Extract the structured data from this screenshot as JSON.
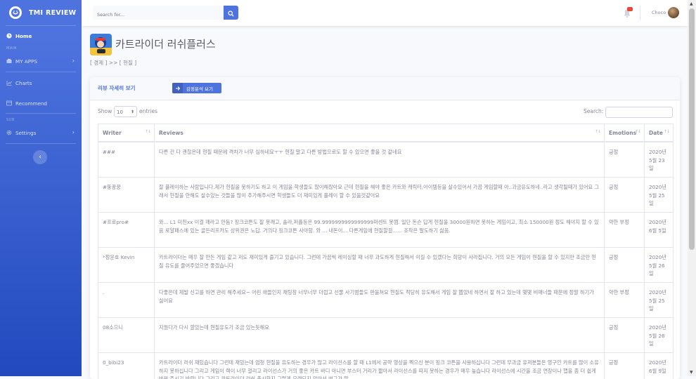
{
  "brand": {
    "name": "TMI REVIEW"
  },
  "sidebar": {
    "home": "Home",
    "heading_main": "MAIN",
    "my_apps": "MY APPS",
    "charts": "Charts",
    "recommend": "Recommend",
    "heading_sub": "SUB",
    "settings": "Settings"
  },
  "topbar": {
    "search_placeholder": "Search for...",
    "notification_count": "",
    "user_name": "Choco"
  },
  "page": {
    "app_title": "카트라이더 러쉬플러스",
    "breadcrumb": "[ 경제 ] >> [ 현질 ]"
  },
  "card": {
    "title": "리뷰 자세히 보기",
    "sentiment_button": "감정분석 보기"
  },
  "table_controls": {
    "show_label": "Show",
    "page_size": "10",
    "entries_label": "entries",
    "search_label": "Search:"
  },
  "table": {
    "headers": [
      "Writer",
      "Reviews",
      "Emotions",
      "Date"
    ],
    "rows": [
      {
        "writer": "###",
        "review": "다른 건 다 괜찮은데 현질 때문에 격차가 너무 심하네요ㅜㅜ 현질 말고 다른 방법으로도 할 수 있으면 좋을 것 같네요",
        "emotion": "긍정",
        "date": "2020년 5월 23일"
      },
      {
        "writer": "#뚱꿍꿍",
        "review": "잘 플레이하는 사람입니다.제가 현질을 못하기도 하고 이 게임을 학생들도 많이해잖아요 근데 현질을 해야 좋은 카트와 캐릭터,아이템등을 살수있어서 가끔 게임할때 아..과금유도하네..라고 생각될때가 있어요 그래서 현질을 안해도 살수있는 것들을 많이 추가해주시면 학생들도 더 재미있게 플레이 할 수 있을것같아요",
        "emotion": "긍정",
        "date": "2020년 5월 25일"
      },
      {
        "writer": "#프로pro#",
        "review": "와... L1 미친xx 이걸 깨라고 만듬? 핑크코튼도 잘 못깨고, 솔라,퍼플등은 99.9999999999999999퍼센트 못깸. 일단 돈슨 답게 현질을 30000원하면 못하는 게임이고, 최소 150000원 정도 해야지 할 수 있음 로얄패스에 있는 골든리프카도 상위권은 노답. 거의다 핑크코튼 사야함. 와 ... 내돈이... 다른게임에 현질할걸...... 조작은 말도하기 싫음.",
        "emotion": "약한 부정",
        "date": "2020년 6월 5일"
      },
      {
        "writer": "*정윤호 Kevin",
        "review": "카트라이더는 매우 잘 만든 게임 같고 저도 재미있게 즐기고 있습니다. 그런데 가끔씩 레이싱할 때 너무 과도하게 현질해서 이길 수 있겠다는 희망이 사라집니다. 거의 모든 게임이 현질을 할 수 있지만 조금만 현질 유도를 줄여주었으면 좋겠습니다",
        "emotion": "긍정",
        "date": "2020년 5월 26일"
      },
      {
        "writer": ".",
        "review": "다좋은데 제발 신고를 하면 관리 해주세요~ 어린 애들인지 채팅창 너무너무 더럽고 선물 사기범들도 판을쳐요 현질도 적당히 유도해서 게임 잘 뽑았네 하면서 잘 하고 있는데 몇몇 비매너들 때문에 정말 하기가 싫어요",
        "emotion": "약한 부정",
        "date": "2020년 5월 25일"
      },
      {
        "writer": "08소으니",
        "review": "지웠다가 다시 깔았는데 현질유도가 조금 있는듯해요",
        "emotion": "긍정",
        "date": "2020년 5월 26일"
      },
      {
        "writer": "0_bibi23",
        "review": "카트라이더 러쉬 재밌습니다 그런데 재밌는데 엄청 현질을 유도하는 경우가 많고 라이선스를 할 때 L1에서 공략 영상을 찍으신 분이 핑크 코튼을 사용하십니다 그런데 무과금 유저분들은 영구인 카트를 많이 소유하지 못하십니다 그리고 게임이 렉이 너무 걸리고 라이선스가 거의 좋은 카트 바디 아니면 부스터 거리가 짧아서 라이선스를 따지 못하는 경우가 매우 높습니다 라이선스에 시간을 조금 연장이나 맵을 좀 더 쉽게 바꿔 주시기 바랍니다 그리고 카트라이더 러쉬 출시한지 그렇게 오래되지 않아서 버그가 많",
        "emotion": "긍정",
        "date": "2020년 6월 9일"
      }
    ]
  },
  "colors": {
    "primary": "#4e73df",
    "sidebar_dark": "#224abe",
    "badge": "#e74a3b"
  },
  "icons": [
    "logo-icon",
    "home-icon",
    "apps-icon",
    "chart-icon",
    "recommend-icon",
    "settings-icon",
    "search-icon",
    "bell-icon",
    "arrow-right-icon",
    "chevron-left-icon"
  ]
}
